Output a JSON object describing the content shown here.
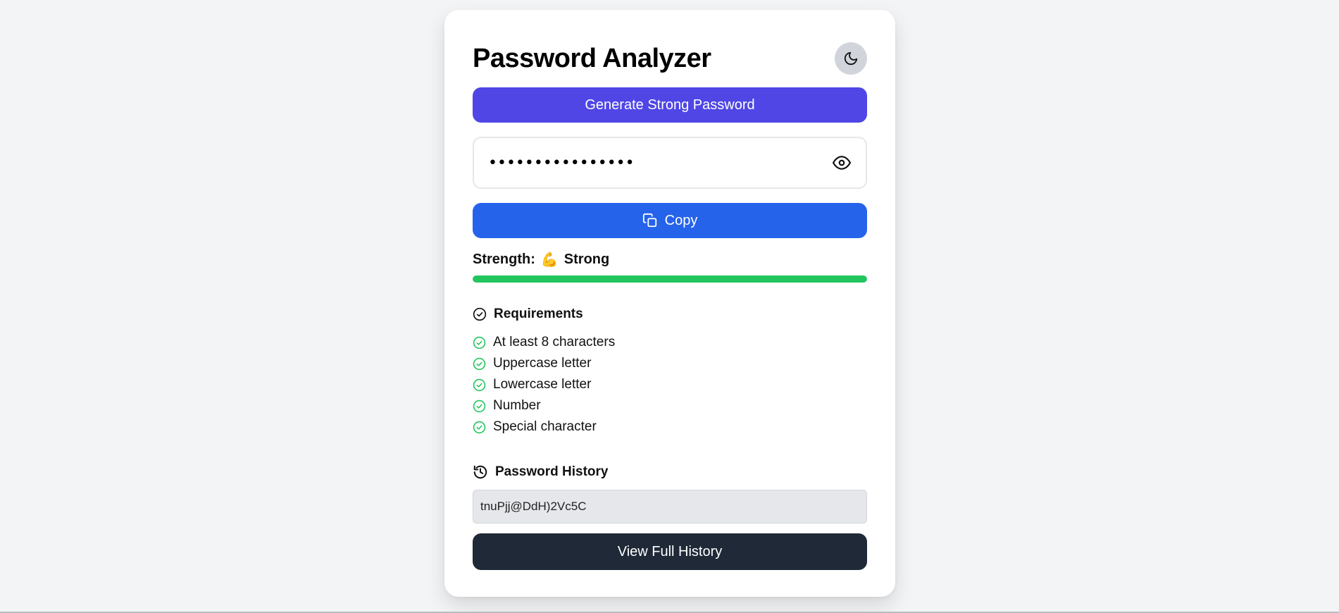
{
  "app": {
    "title": "Password Analyzer"
  },
  "theme_toggle": {
    "icon": "moon-icon"
  },
  "generate": {
    "label": "Generate Strong Password"
  },
  "password": {
    "masked_value": "••••••••••••••••",
    "visibility_icon": "eye-icon"
  },
  "copy": {
    "label": "Copy",
    "icon": "copy-icon"
  },
  "strength": {
    "label": "Strength:",
    "emoji": "💪",
    "value": "Strong",
    "level_fraction": 1.0,
    "color": "#22c55e"
  },
  "requirements": {
    "title": "Requirements",
    "items": [
      {
        "label": "At least 8 characters",
        "met": true
      },
      {
        "label": "Uppercase letter",
        "met": true
      },
      {
        "label": "Lowercase letter",
        "met": true
      },
      {
        "label": "Number",
        "met": true
      },
      {
        "label": "Special character",
        "met": true
      }
    ]
  },
  "history": {
    "title": "Password History",
    "entries": [
      "tnuPjj@DdH)2Vc5C"
    ],
    "view_all_label": "View Full History"
  },
  "colors": {
    "generate_button": "#4f46e5",
    "copy_button": "#2563eb",
    "history_button": "#1f2937",
    "check": "#22c55e"
  }
}
